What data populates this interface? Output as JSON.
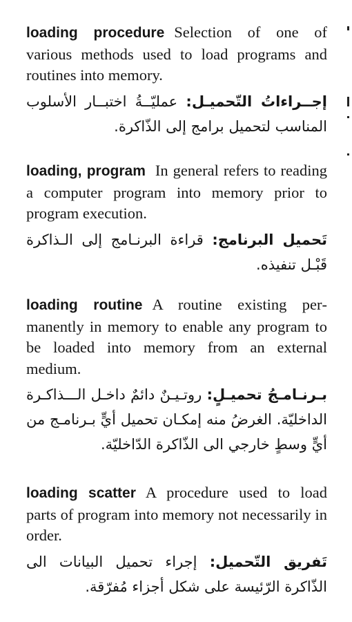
{
  "page": {
    "entries": [
      {
        "term": "loading procedure",
        "definition_en": "Selection of one of various methods used to load programs and routines into memory.",
        "term_ar": "إجــراءاتُ التّحميـل:",
        "definition_ar": "عمليّــةُ اختبــار الأسلوب المناسب لتحميل برامج إلى الذّاكرة."
      },
      {
        "term": "loading, program",
        "definition_en": "In general refers to reading a computer program into memory prior to program execution.",
        "term_ar": "تَحميل البرنامج:",
        "definition_ar": "قراءة البرنـامج إلى الـذاكرة قَبْـل تنفيذه."
      },
      {
        "term": "loading routine",
        "definition_en": "A routine existing per­manently in memory to enable any prog­ram to be loaded into memory from an ex­ternal medium.",
        "term_ar": "بـرنـامـجُ تحميـلٍ:",
        "definition_ar": "روتـيـنٌ دائمٌ داخـل الـــذاكـرة الداخليّة. الغرضُ منه إمكـان تحميل أيٍّ بـرنامـج من أيٍّ وسطٍ خارجي الى الذّاكرة الدّاخليّة."
      },
      {
        "term": "loading scatter",
        "definition_en": "A procedure used to load parts of program into memory not necessarily in order.",
        "term_ar": "تَفريق التّحميل:",
        "definition_ar": "إجراء تحميل البيانات الى الذّاكرة الرّئيسة على شكل أجزاء مُفرّقة."
      }
    ]
  }
}
